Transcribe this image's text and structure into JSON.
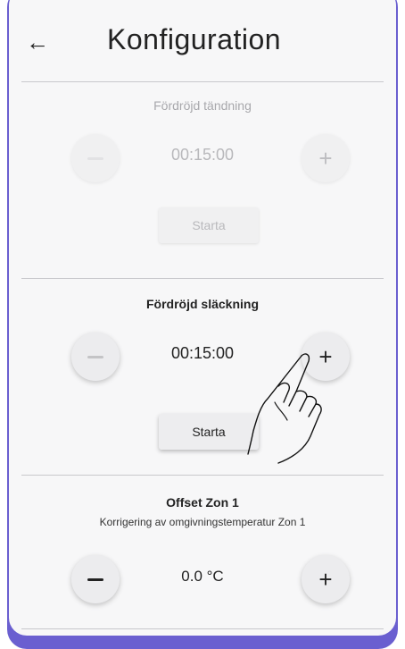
{
  "header": {
    "back_icon": "arrow-left-icon",
    "title": "Konfiguration"
  },
  "sections": [
    {
      "title": "Fördröjd tändning",
      "value": "00:15:00",
      "start_label": "Starta",
      "state": "disabled"
    },
    {
      "title": "Fördröjd släckning",
      "value": "00:15:00",
      "start_label": "Starta",
      "state": "active"
    },
    {
      "title": "Offset Zon 1",
      "subtitle": "Korrigering av omgivningstemperatur Zon 1",
      "value": "0.0 °C"
    }
  ],
  "icons": {
    "minus": "minus-icon",
    "plus": "plus-icon",
    "hand": "pointing-hand-icon"
  },
  "colors": {
    "device_frame": "#6a5fd0",
    "screen_bg": "#f7f7f8",
    "divider": "#c8c8cc"
  }
}
